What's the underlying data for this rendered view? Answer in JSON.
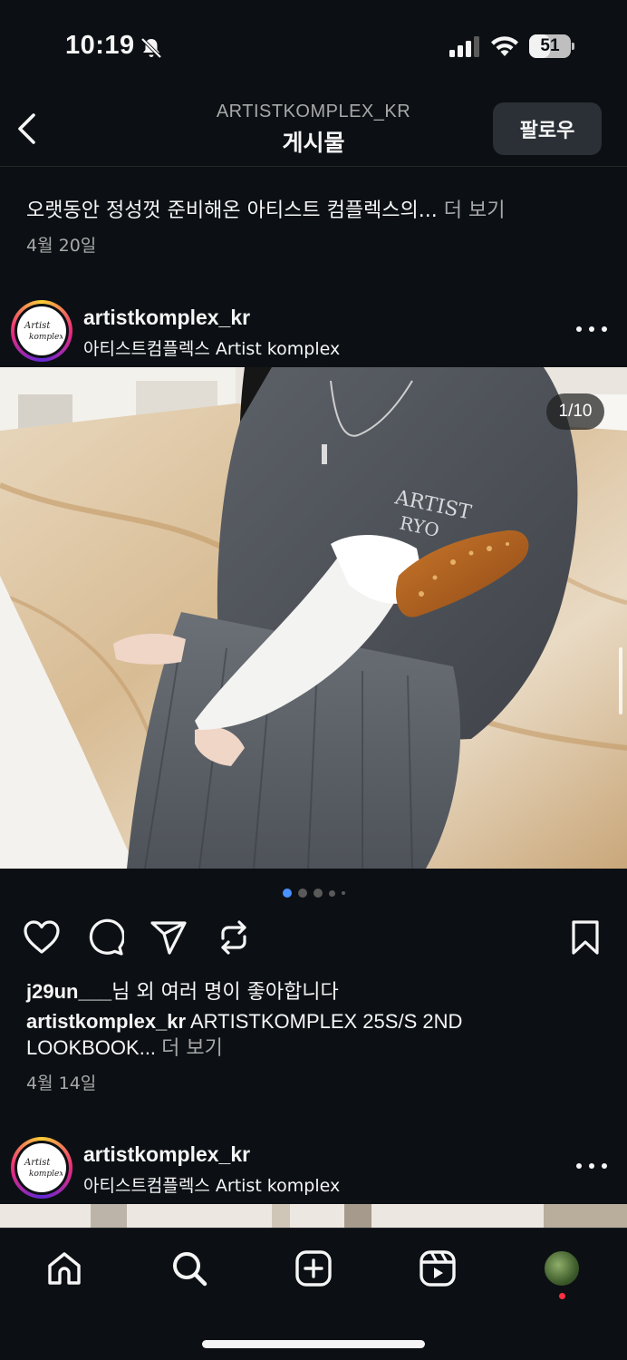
{
  "status_bar": {
    "time": "10:19",
    "battery_level": "51",
    "battery_fraction": 0.51
  },
  "header": {
    "account": "ARTISTKOMPLEX_KR",
    "title": "게시물",
    "follow_label": "팔로우"
  },
  "previous_post": {
    "caption": "오랫동안 정성껏 준비해온 아티스트 컴플렉스의...",
    "more_label": "더 보기",
    "date": "4월 20일"
  },
  "post": {
    "username": "artistkomplex_kr",
    "subtitle": "아티스트컴플렉스 Artist komplex",
    "avatar_text": "Artist komplex",
    "counter": "1/10",
    "liked_by_user": "j29un___",
    "likes_text": "님 외 여러 명이 좋아합니다",
    "caption_username": "artistkomplex_kr",
    "caption_text": "ARTISTKOMPLEX 25S/S 2ND LOOKBOOK...",
    "more_label": "더 보기",
    "date": "4월 14일",
    "carousel_dots": 5,
    "active_dot": 0
  },
  "next_post": {
    "username": "artistkomplex_kr",
    "subtitle": "아티스트컴플렉스 Artist komplex"
  },
  "icons": {
    "back": "chevron-left-icon",
    "like": "heart-icon",
    "comment": "comment-icon",
    "share": "paper-plane-icon",
    "repost": "repost-icon",
    "save": "bookmark-icon",
    "nav": [
      "home-icon",
      "search-icon",
      "create-icon",
      "reels-icon",
      "profile-icon"
    ]
  },
  "colors": {
    "background": "#0c1014",
    "text": "#f5f5f5",
    "secondary_text": "#a8a8a8",
    "accent_blue": "#4a90ff",
    "notification": "#ff3040"
  }
}
